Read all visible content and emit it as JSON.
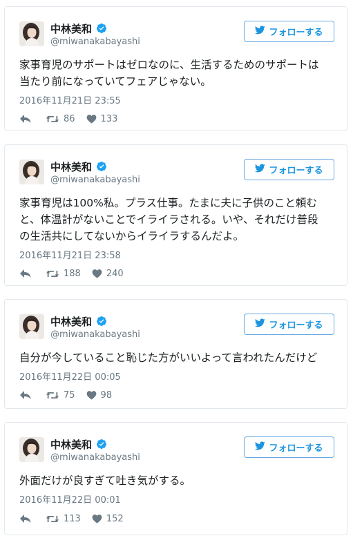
{
  "follow_label": "フォローする",
  "colors": {
    "accent": "#1b95e0",
    "verified": "#1da1f2",
    "meta": "#697882",
    "border": "#e1e8ed"
  },
  "icons": [
    "avatar-photo",
    "verified-badge-icon",
    "twitter-bird-icon",
    "reply-icon",
    "retweet-icon",
    "heart-icon"
  ],
  "tweets": [
    {
      "name": "中林美和",
      "handle": "@miwanakabayashi",
      "text": "家事育児のサポートはゼロなのに、生活するためのサポートは\n当たり前になっていてフェアじゃない。",
      "timestamp": "2016年11月21日 23:55",
      "retweets": "86",
      "likes": "133"
    },
    {
      "name": "中林美和",
      "handle": "@miwanakabayashi",
      "text": "家事育児は100%私。プラス仕事。たまに夫に子供のこと頼む\nと、体温計がないことでイライラされる。いや、それだけ普段\nの生活共にしてないからイライラするんだよ。",
      "timestamp": "2016年11月21日 23:58",
      "retweets": "188",
      "likes": "240"
    },
    {
      "name": "中林美和",
      "handle": "@miwanakabayashi",
      "text": "自分が今していること恥じた方がいいよって言われたんだけど",
      "timestamp": "2016年11月22日 00:05",
      "retweets": "75",
      "likes": "98"
    },
    {
      "name": "中林美和",
      "handle": "@miwanakabayashi",
      "text": "外面だけが良すぎて吐き気がする。",
      "timestamp": "2016年11月22日 00:01",
      "retweets": "113",
      "likes": "152"
    }
  ]
}
